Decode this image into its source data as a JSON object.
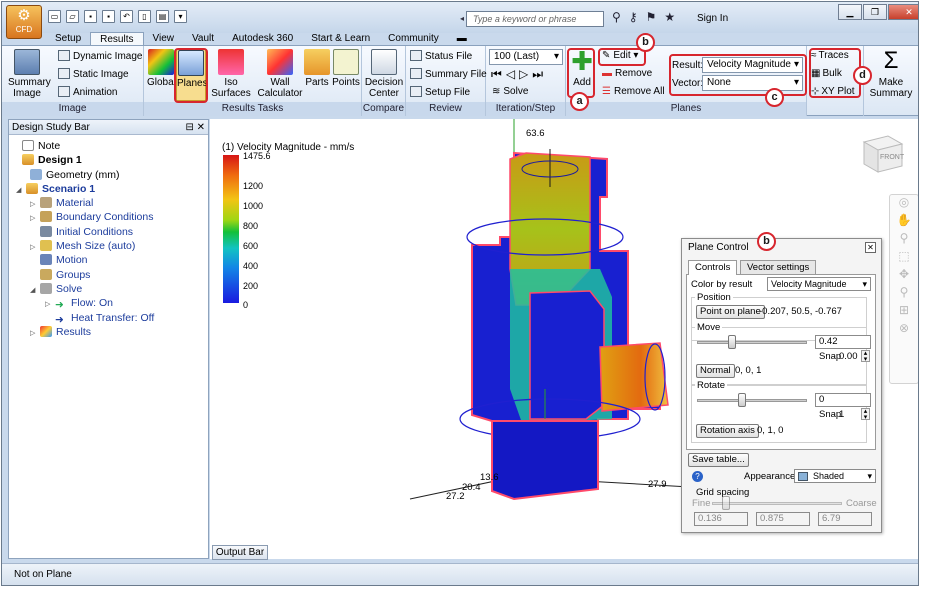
{
  "app": {
    "name": "CFD",
    "search_placeholder": "Type a keyword or phrase",
    "sign_in": "Sign In",
    "help": "?"
  },
  "tabs": [
    "Setup",
    "Results",
    "View",
    "Vault",
    "Autodesk 360",
    "Start & Learn",
    "Community"
  ],
  "active_tab": "Results",
  "ribbon": {
    "image_group": {
      "label": "Image",
      "summary_image": "Summary Image",
      "dynamic_image": "Dynamic Image",
      "static_image": "Static Image",
      "animation": "Animation"
    },
    "results_tasks": {
      "label": "Results Tasks",
      "global": "Global",
      "planes": "Planes",
      "iso_surfaces": "Iso Surfaces",
      "wall_calculator": "Wall Calculator",
      "parts": "Parts",
      "points": "Points"
    },
    "compare": {
      "label": "Compare",
      "decision_center": "Decision Center"
    },
    "review": {
      "label": "Review",
      "status_file": "Status File",
      "summary_file": "Summary File",
      "setup_file": "Setup File"
    },
    "iteration": {
      "label": "Iteration/Step",
      "value": "100 (Last)",
      "solve": "Solve"
    },
    "planes": {
      "label": "Planes",
      "add": "Add",
      "edit": "Edit",
      "remove": "Remove",
      "remove_all": "Remove All",
      "result_label": "Result:",
      "result_value": "Velocity Magnitude",
      "vector_label": "Vector:",
      "vector_value": "None",
      "traces": "Traces",
      "bulk": "Bulk",
      "xy_plot": "XY Plot"
    },
    "make_summary": "Make Summary"
  },
  "annotations": {
    "a": "a",
    "b": "b",
    "c": "c",
    "d": "d"
  },
  "design_study_bar": {
    "title": "Design Study Bar",
    "items": [
      {
        "label": "Note",
        "level": 0
      },
      {
        "label": "Design 1",
        "level": 0
      },
      {
        "label": "Geometry (mm)",
        "level": 1
      },
      {
        "label": "Scenario 1",
        "level": 1
      },
      {
        "label": "Material",
        "level": 2
      },
      {
        "label": "Boundary Conditions",
        "level": 2
      },
      {
        "label": "Initial Conditions",
        "level": 2
      },
      {
        "label": "Mesh Size (auto)",
        "level": 2
      },
      {
        "label": "Motion",
        "level": 2
      },
      {
        "label": "Groups",
        "level": 2
      },
      {
        "label": "Solve",
        "level": 2
      },
      {
        "label": "Flow: On",
        "level": 3
      },
      {
        "label": "Heat Transfer: Off",
        "level": 3
      },
      {
        "label": "Results",
        "level": 2
      }
    ]
  },
  "viewport": {
    "legend_title": "(1) Velocity Magnitude - mm/s",
    "legend_ticks": [
      "1475.6",
      "1200",
      "1000",
      "800",
      "600",
      "400",
      "200",
      "0"
    ],
    "axis_labels": {
      "top": "63.6",
      "left_a": "13.6",
      "left_b": "20.4",
      "left_c": "27.2",
      "right": "27.9"
    },
    "viewcube_face": "FRONT"
  },
  "plane_control": {
    "title": "Plane Control",
    "tab_controls": "Controls",
    "tab_vector": "Vector settings",
    "color_by_label": "Color by result",
    "color_by_value": "Velocity Magnitude",
    "position_label": "Position",
    "point_on_plane": "Point on plane",
    "point_value": "-0.207, 50.5, -0.767",
    "move_label": "Move",
    "move_value": "0.42",
    "move_fraction": 0.3,
    "snap_label": "Snap",
    "move_snap": "0.00",
    "normal_btn": "Normal",
    "normal_value": "0, 0, 1",
    "rotate_label": "Rotate",
    "rotate_value": "0",
    "rotate_fraction": 0.4,
    "rotate_snap": "1",
    "rotation_axis_btn": "Rotation axis",
    "rotation_axis_value": "0, 1, 0",
    "save_table": "Save table...",
    "appearance_label": "Appearance:",
    "appearance_value": "Shaded",
    "grid_spacing_label": "Grid spacing",
    "fine_label": "Fine",
    "coarse_label": "Coarse",
    "grid_values": [
      "0.136",
      "0.875",
      "6.79"
    ]
  },
  "output_bar": "Output Bar",
  "status_text": "Not on Plane"
}
